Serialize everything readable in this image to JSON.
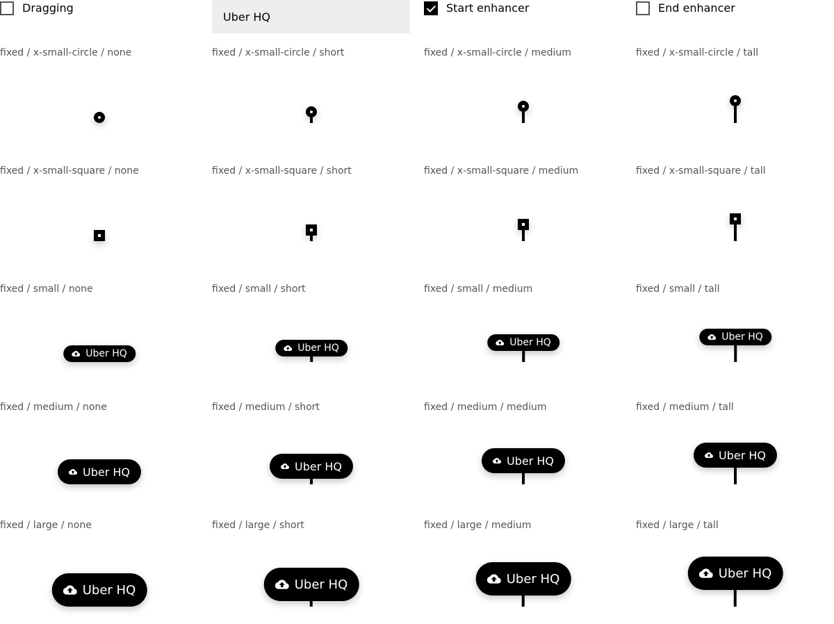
{
  "controls": {
    "dragging_label": "Dragging",
    "dragging_checked": false,
    "input_value": "Uber HQ",
    "start_enhancer_label": "Start enhancer",
    "start_enhancer_checked": true,
    "end_enhancer_label": "End enhancer",
    "end_enhancer_checked": false
  },
  "marker_label": "Uber HQ",
  "marker_icon": "cloud-upload-icon",
  "rows": [
    {
      "size": "x-small-circle",
      "cells": [
        {
          "label": "fixed / x-small-circle / none"
        },
        {
          "label": "fixed / x-small-circle / short"
        },
        {
          "label": "fixed / x-small-circle / medium"
        },
        {
          "label": "fixed / x-small-circle / tall"
        }
      ]
    },
    {
      "size": "x-small-square",
      "cells": [
        {
          "label": "fixed / x-small-square / none"
        },
        {
          "label": "fixed / x-small-square / short"
        },
        {
          "label": "fixed / x-small-square / medium"
        },
        {
          "label": "fixed / x-small-square / tall"
        }
      ]
    },
    {
      "size": "small",
      "cells": [
        {
          "label": "fixed / small / none"
        },
        {
          "label": "fixed / small / short"
        },
        {
          "label": "fixed / small / medium"
        },
        {
          "label": "fixed / small / tall"
        }
      ]
    },
    {
      "size": "medium",
      "cells": [
        {
          "label": "fixed / medium / none"
        },
        {
          "label": "fixed / medium / short"
        },
        {
          "label": "fixed / medium / medium"
        },
        {
          "label": "fixed / medium / tall"
        }
      ]
    },
    {
      "size": "large",
      "cells": [
        {
          "label": "fixed / large / none"
        },
        {
          "label": "fixed / large / short"
        },
        {
          "label": "fixed / large / medium"
        },
        {
          "label": "fixed / large / tall"
        }
      ]
    }
  ]
}
